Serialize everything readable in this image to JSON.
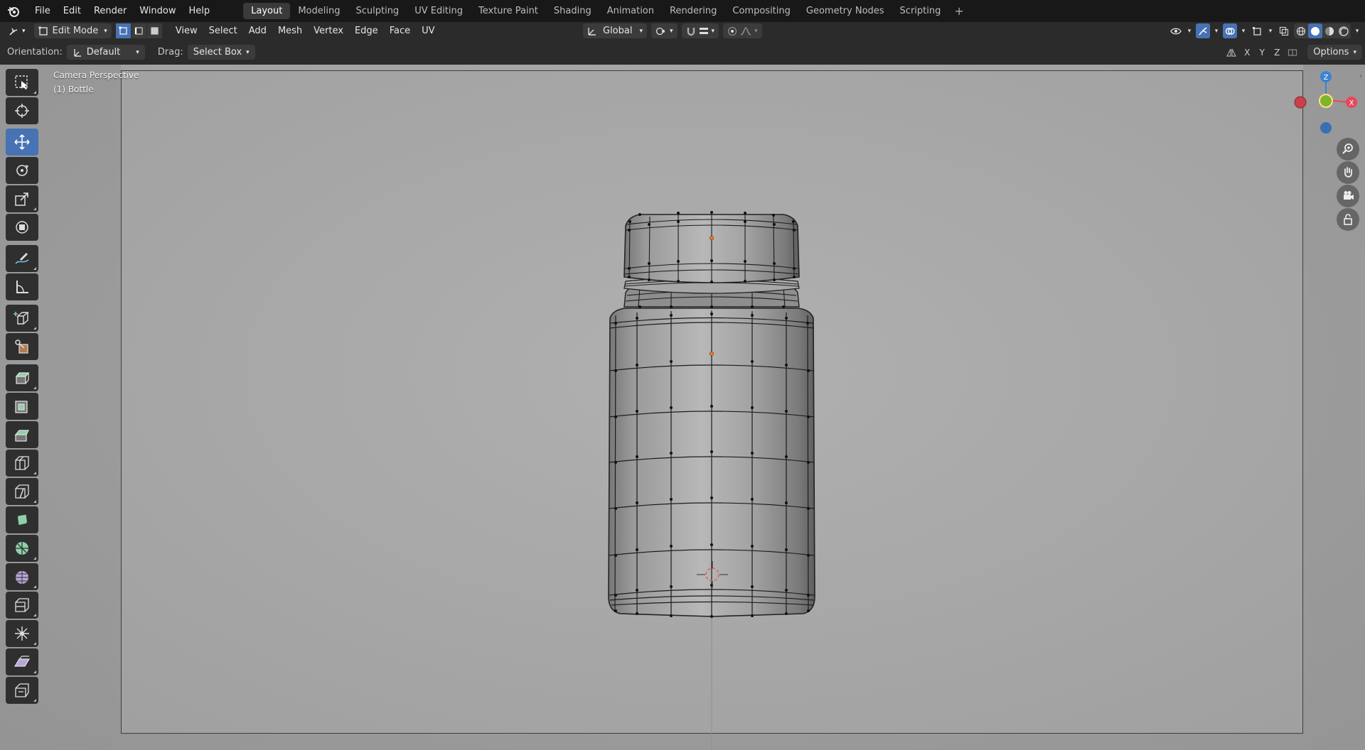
{
  "topbar": {
    "menus": [
      "File",
      "Edit",
      "Render",
      "Window",
      "Help"
    ],
    "workspaces": [
      "Layout",
      "Modeling",
      "Sculpting",
      "UV Editing",
      "Texture Paint",
      "Shading",
      "Animation",
      "Rendering",
      "Compositing",
      "Geometry Nodes",
      "Scripting"
    ],
    "active_workspace": "Layout"
  },
  "header": {
    "mode": "Edit Mode",
    "menus": [
      "View",
      "Select",
      "Add",
      "Mesh",
      "Vertex",
      "Edge",
      "Face",
      "UV"
    ],
    "transform_orientation": "Global"
  },
  "tool_settings": {
    "orientation_label": "Orientation:",
    "orientation_value": "Default",
    "drag_label": "Drag:",
    "drag_value": "Select Box",
    "axes": [
      "X",
      "Y",
      "Z"
    ],
    "options_label": "Options"
  },
  "viewport": {
    "view_name": "Camera Perspective",
    "object_name": "(1) Bottle"
  },
  "gizmo": {
    "z_label": "Z",
    "x_label": "X",
    "colors": {
      "x": "#e8475a",
      "y": "#7fb52b",
      "z": "#3b82d1"
    }
  },
  "colors": {
    "accent": "#4772b3",
    "selected_vertex": "#ff7a1a"
  }
}
